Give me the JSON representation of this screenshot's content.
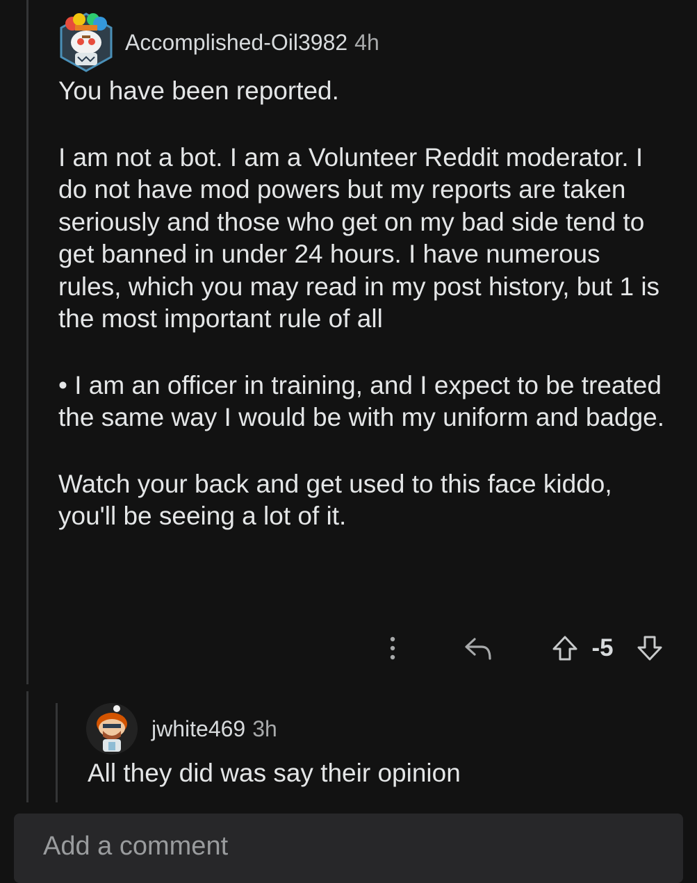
{
  "comment": {
    "username": "Accomplished-Oil3982",
    "time": "4h",
    "paragraphs": [
      "You have been reported.",
      "I am not a bot. I am a Volunteer Reddit moderator. I do not have mod powers but my reports are taken seriously and those who get on my bad side tend to get banned in under 24 hours. I have numerous rules, which you may read in my post history, but 1 is the most important rule of all",
      "• I am an officer in training, and I expect to be treated the same way I would be with my uniform and badge.",
      "Watch your back and get used to this face kiddo, you'll be seeing a lot of it."
    ],
    "score": "-5",
    "icons": {
      "more": "more-vertical-icon",
      "reply": "reply-icon",
      "upvote": "upvote-arrow-icon",
      "downvote": "downvote-arrow-icon"
    }
  },
  "reply": {
    "username": "jwhite469",
    "time": "3h",
    "text": "All they did was say their opinion"
  },
  "composer": {
    "placeholder": "Add a comment"
  },
  "colors": {
    "background": "#121212",
    "text": "#d7dadc",
    "thread_line": "#343536",
    "composer_bg": "#272729"
  }
}
